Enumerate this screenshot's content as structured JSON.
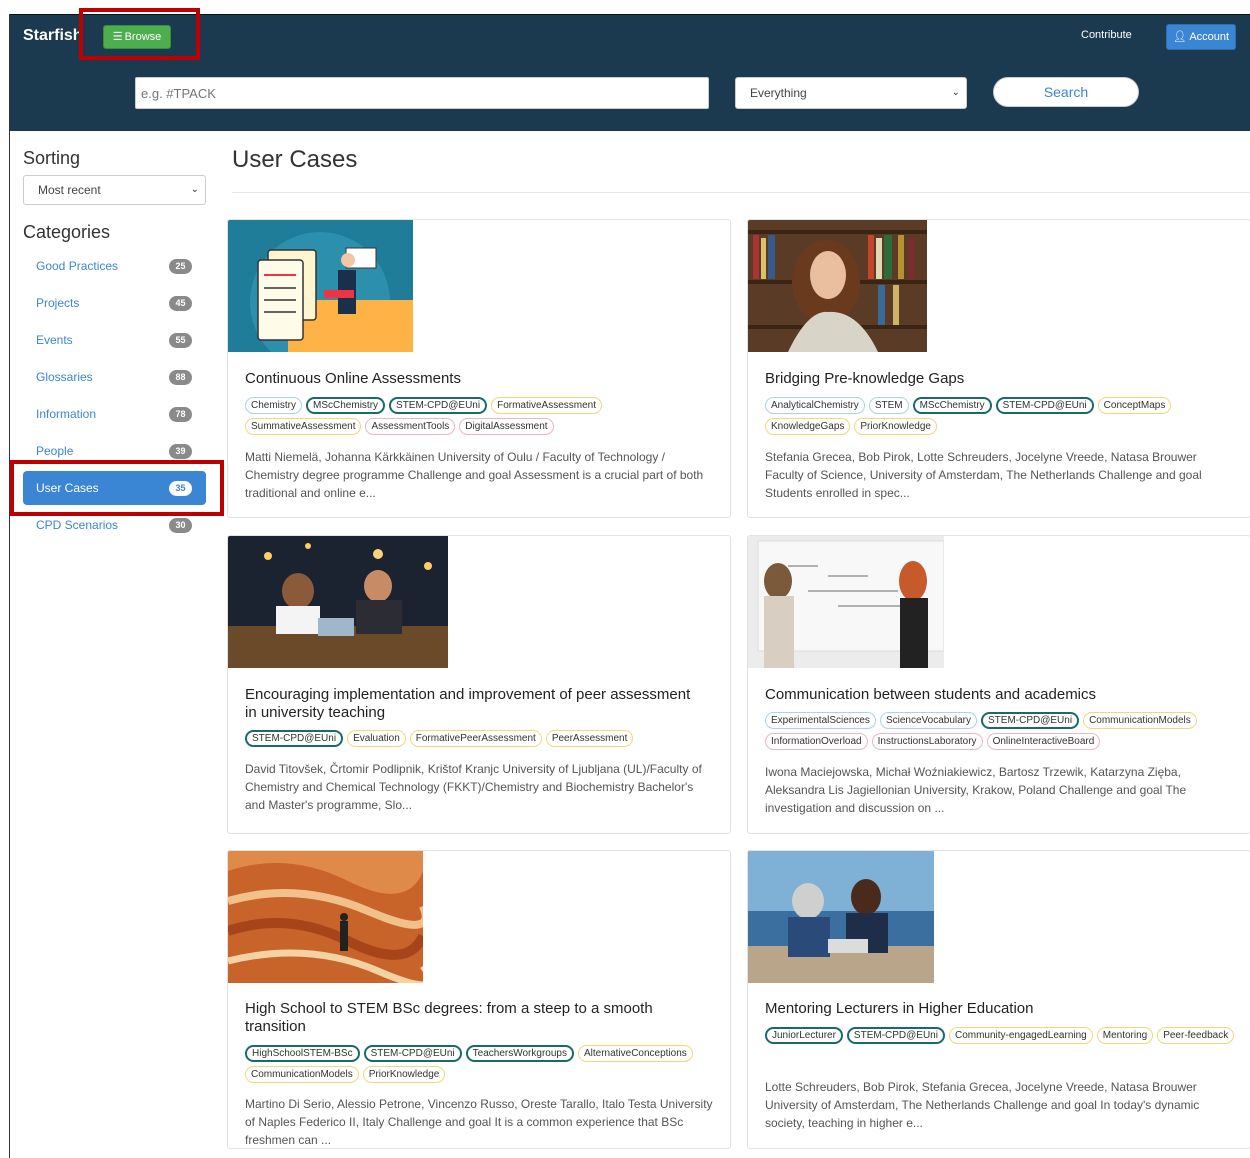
{
  "header": {
    "brand": "Starfish",
    "browse_label": "Browse",
    "contribute_label": "Contribute",
    "account_label": "Account",
    "search_placeholder": "e.g. #TPACK",
    "scope_selected": "Everything",
    "search_button": "Search"
  },
  "sidebar": {
    "sorting_heading": "Sorting",
    "sort_selected": "Most recent",
    "categories_heading": "Categories",
    "items": [
      {
        "label": "Good Practices",
        "count": "25"
      },
      {
        "label": "Projects",
        "count": "45"
      },
      {
        "label": "Events",
        "count": "55"
      },
      {
        "label": "Glossaries",
        "count": "88"
      },
      {
        "label": "Information",
        "count": "78"
      },
      {
        "label": "People",
        "count": "39"
      },
      {
        "label": "User Cases",
        "count": "35"
      },
      {
        "label": "CPD Scenarios",
        "count": "30"
      }
    ]
  },
  "main": {
    "title": "User Cases",
    "cards": [
      {
        "title": "Continuous Online Assessments",
        "tags": [
          {
            "text": "Chemistry",
            "style": "blue"
          },
          {
            "text": "MScChemistry",
            "style": "teal"
          },
          {
            "text": "STEM-CPD@EUni",
            "style": "teal"
          },
          {
            "text": "FormativeAssessment",
            "style": "yellow"
          },
          {
            "text": "SummativeAssessment",
            "style": "yellow"
          },
          {
            "text": "AssessmentTools",
            "style": "pink"
          },
          {
            "text": "DigitalAssessment",
            "style": "pink"
          }
        ],
        "desc": "Matti Niemelä, Johanna Kärkkäinen University of Oulu / Faculty of Technology / Chemistry degree programme Challenge and goal Assessment is a crucial part of both traditional and online e..."
      },
      {
        "title": "Bridging Pre-knowledge Gaps",
        "tags": [
          {
            "text": "AnalyticalChemistry",
            "style": "blue"
          },
          {
            "text": "STEM",
            "style": "blue"
          },
          {
            "text": "MScChemistry",
            "style": "teal"
          },
          {
            "text": "STEM-CPD@EUni",
            "style": "teal"
          },
          {
            "text": "ConceptMaps",
            "style": "yellow"
          },
          {
            "text": "KnowledgeGaps",
            "style": "yellow"
          },
          {
            "text": "PriorKnowledge",
            "style": "yellow"
          }
        ],
        "desc": "Stefania Grecea, Bob Pirok, Lotte Schreuders, Jocelyne Vreede, Natasa Brouwer Faculty of Science, University of Amsterdam, The Netherlands Challenge and goal Students enrolled in spec..."
      },
      {
        "title": "Encouraging implementation and improvement of peer assessment in university teaching",
        "tags": [
          {
            "text": "STEM-CPD@EUni",
            "style": "teal"
          },
          {
            "text": "Evaluation",
            "style": "yellow"
          },
          {
            "text": "FormativePeerAssessment",
            "style": "yellow"
          },
          {
            "text": "PeerAssessment",
            "style": "yellow"
          }
        ],
        "desc": "David Titovšek, Črtomir Podlipnik, Krištof Kranjc University of Ljubljana (UL)/Faculty of Chemistry and Chemical Technology (FKKT)/Chemistry and Biochemistry Bachelor's and Master's programme, Slo..."
      },
      {
        "title": "Communication between students and academics",
        "tags": [
          {
            "text": "ExperimentalSciences",
            "style": "blue"
          },
          {
            "text": "ScienceVocabulary",
            "style": "blue"
          },
          {
            "text": "STEM-CPD@EUni",
            "style": "teal"
          },
          {
            "text": "CommunicationModels",
            "style": "yellow"
          },
          {
            "text": "InformationOverload",
            "style": "pink"
          },
          {
            "text": "InstructionsLaboratory",
            "style": "pink"
          },
          {
            "text": "OnlineInteractiveBoard",
            "style": "pink"
          }
        ],
        "desc": "Iwona Maciejowska, Michał Woźniakiewicz, Bartosz Trzewik, Katarzyna Zięba, Aleksandra Lis Jagiellonian University, Krakow, Poland Challenge and goal The investigation and discussion on ..."
      },
      {
        "title": "High School to STEM BSc degrees: from a steep to a smooth transition",
        "tags": [
          {
            "text": "HighSchoolSTEM-BSc",
            "style": "teal"
          },
          {
            "text": "STEM-CPD@EUni",
            "style": "teal"
          },
          {
            "text": "TeachersWorkgroups",
            "style": "teal"
          },
          {
            "text": "AlternativeConceptions",
            "style": "yellow"
          },
          {
            "text": "CommunicationModels",
            "style": "yellow"
          },
          {
            "text": "PriorKnowledge",
            "style": "yellow"
          }
        ],
        "desc": "Martino Di Serio, Alessio Petrone, Vincenzo Russo, Oreste Tarallo, Italo Testa University of Naples Federico II, Italy Challenge and goal It is a common experience that BSc freshmen can ..."
      },
      {
        "title": "Mentoring Lecturers in Higher Education",
        "tags": [
          {
            "text": "JuniorLecturer",
            "style": "teal"
          },
          {
            "text": "STEM-CPD@EUni",
            "style": "teal"
          },
          {
            "text": "Community-engagedLearning",
            "style": "yellow"
          },
          {
            "text": "Mentoring",
            "style": "yellow"
          },
          {
            "text": "Peer-feedback",
            "style": "yellow"
          }
        ],
        "desc": "Lotte Schreuders, Bob Pirok, Stefania Grecea, Jocelyne Vreede, Natasa Brouwer University of Amsterdam, The Netherlands Challenge and goal In today's dynamic society, teaching in higher e..."
      }
    ]
  },
  "icons": {
    "browse": "list-icon",
    "account": "user-icon",
    "select": "chevron-down-icon"
  },
  "colors": {
    "header_bg": "#1c3a4f",
    "browse_green": "#4cae4c",
    "accent_blue": "#3a86d4",
    "highlight_red": "#c00000"
  }
}
